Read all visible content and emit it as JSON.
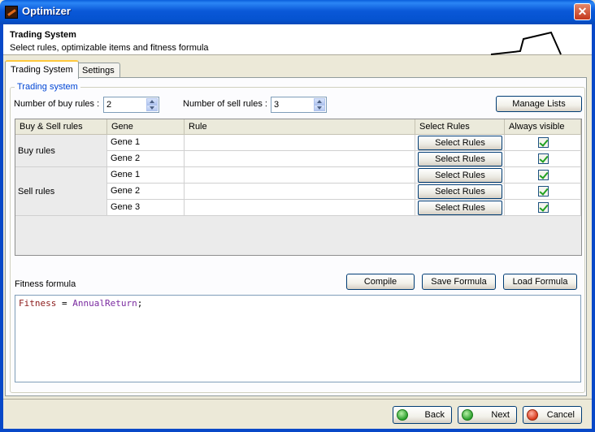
{
  "window": {
    "title": "Optimizer",
    "close_glyph": "✕"
  },
  "header": {
    "title": "Trading System",
    "subtitle": "Select rules, optimizable items and fitness formula"
  },
  "tabs": [
    {
      "label": "Trading System",
      "active": true
    },
    {
      "label": "Settings",
      "active": false
    }
  ],
  "group": {
    "legend": "Trading system"
  },
  "buy_rules": {
    "label": "Number of buy rules :",
    "value": "2"
  },
  "sell_rules": {
    "label": "Number of sell rules :",
    "value": "3"
  },
  "manage_lists_label": "Manage Lists",
  "table": {
    "columns": [
      "Buy & Sell rules",
      "Gene",
      "Rule",
      "Select Rules",
      "Always visible"
    ],
    "groups": [
      {
        "label": "Buy rules",
        "rows": [
          {
            "gene": "Gene 1",
            "rule": "",
            "button": "Select Rules",
            "always_visible": true
          },
          {
            "gene": "Gene 2",
            "rule": "",
            "button": "Select Rules",
            "always_visible": true
          }
        ]
      },
      {
        "label": "Sell rules",
        "rows": [
          {
            "gene": "Gene 1",
            "rule": "",
            "button": "Select Rules",
            "always_visible": true
          },
          {
            "gene": "Gene 2",
            "rule": "",
            "button": "Select Rules",
            "always_visible": true
          },
          {
            "gene": "Gene 3",
            "rule": "",
            "button": "Select Rules",
            "always_visible": true
          }
        ]
      }
    ]
  },
  "fitness": {
    "label": "Fitness formula",
    "compile_label": "Compile",
    "save_label": "Save Formula",
    "load_label": "Load Formula",
    "code": {
      "lhs": "Fitness",
      "op": " = ",
      "rhs": "AnnualReturn",
      "end": ";"
    }
  },
  "footer": {
    "back_label": "Back",
    "next_label": "Next",
    "cancel_label": "Cancel"
  },
  "colors": {
    "title_bar": "#0a58d8",
    "accent_tab": "#ffc83c",
    "legend": "#0046d5"
  }
}
